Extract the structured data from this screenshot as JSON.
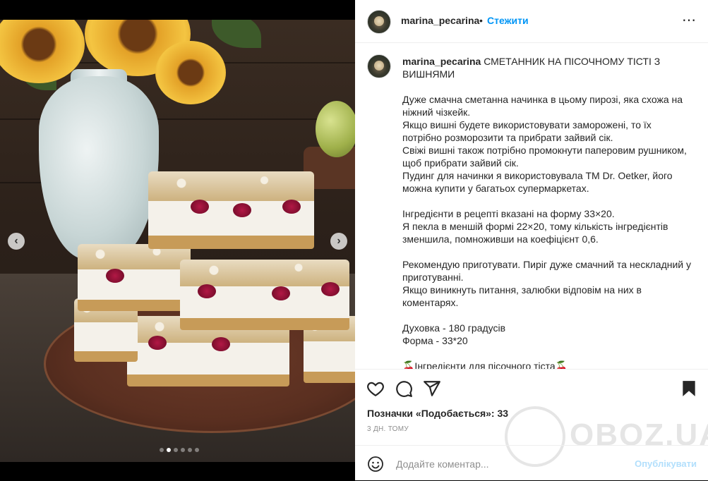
{
  "post": {
    "username": "marina_pecarina",
    "separator": "•",
    "follow_label": "Стежити",
    "more_icon": "⋯",
    "caption_title": "СМЕТАННИК НА ПІСОЧНОМУ ТІСТІ З ВИШНЯМИ",
    "caption_body": "Дуже смачна сметанна начинка в цьому пирозі, яка схожа на ніжний чізкейк.\nЯкщо вишні будете використовувати заморожені, то їх потрібно розморозити та прибрати зайвий сік.\nСвіжі вишні також потрібно промокнути паперовим рушником, щоб прибрати зайвий сік.\nПудинг для начинки я використовувала ТМ Dr. Oetker, його можна купити у багатьох супермаркетах.\n\nІнгредієнти в рецептi вказані на форму 33×20.\nЯ пекла в меншій формі 22×20, тому кількість інгредієнтів зменшила, помноживши на коефіцієнт 0,6.\n\nРекомендую приготувати. Пиріг дуже смачний та нескладний у приготуванні.\nЯкщо виникнуть питання, залюбки відповім на них в коментарях.\n\nДуховка - 180 градусів\nФорма - 33*20\n\n🍒Інгредієнти для пісочного тіста🍒",
    "likes_text": "Позначки «Подобається»: 33",
    "time_text": "3 ДН. ТОМУ"
  },
  "comment": {
    "placeholder": "Додайте коментар...",
    "publish_label": "Опублікувати"
  },
  "carousel": {
    "slide_count": 6,
    "active_index": 1,
    "prev_arrow": "‹",
    "next_arrow": "›"
  },
  "watermark": {
    "text": "OBOZ.UA"
  },
  "colors": {
    "accent": "#0095f6",
    "publish_disabled": "#b2dffc",
    "muted": "#8e8e8e",
    "border": "#efefef"
  }
}
